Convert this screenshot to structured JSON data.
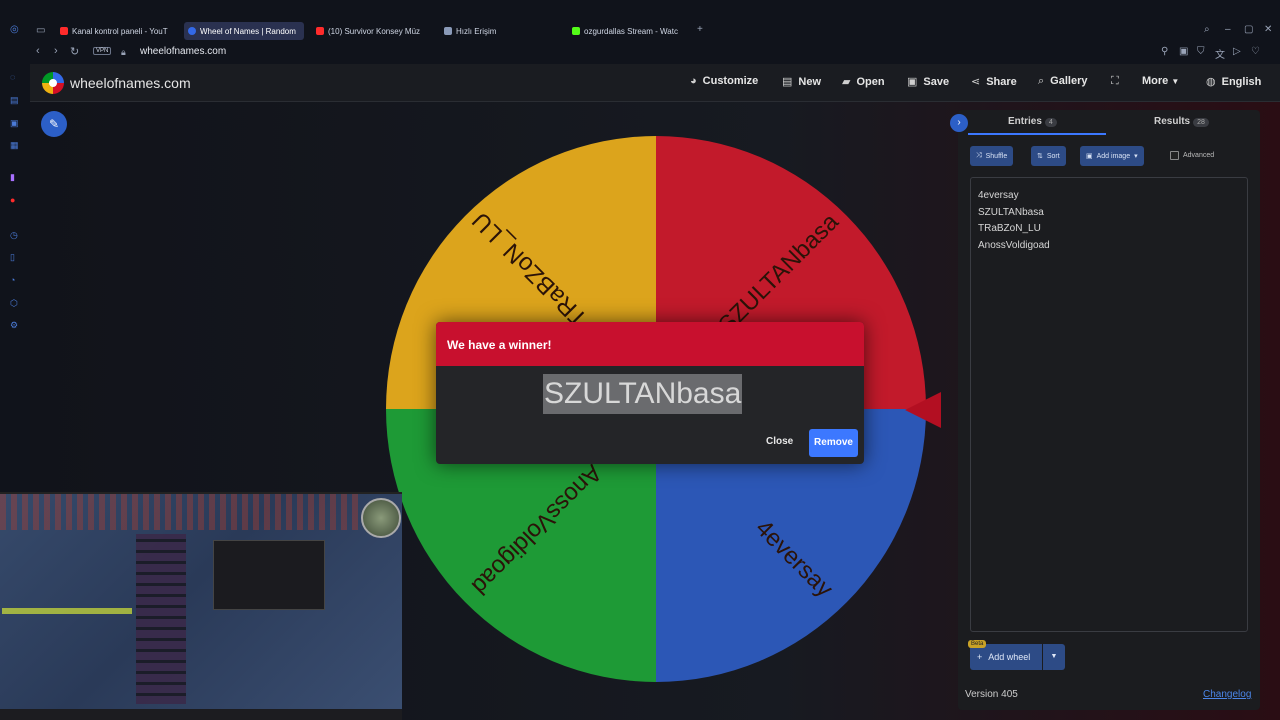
{
  "browser": {
    "tabs": [
      {
        "label": "Kanal kontrol paneli - YouT",
        "color": "#ff2b2b"
      },
      {
        "label": "Wheel of Names | Random",
        "color": "#3369e8",
        "active": true
      },
      {
        "label": "(10) Survivor Konsey Müz",
        "color": "#ff2b2b"
      },
      {
        "label": "Hızlı Erişim",
        "color": "#8a9ab8"
      },
      {
        "label": "ozgurdallas Stream - Watc",
        "color": "#53fc18"
      }
    ],
    "new_tab": "+",
    "vpn": "VPN",
    "url": "wheelofnames.com"
  },
  "header": {
    "site_title": "wheelofnames.com",
    "menu": {
      "customize": "Customize",
      "new": "New",
      "open": "Open",
      "save": "Save",
      "share": "Share",
      "gallery": "Gallery",
      "more": "More",
      "language": "English"
    },
    "icons": {
      "customize": "palette-icon",
      "new": "file-icon",
      "open": "folder-icon",
      "save": "save-icon",
      "share": "share-icon",
      "gallery": "search-icon",
      "fullscreen": "fullscreen-icon",
      "language": "globe-icon"
    }
  },
  "wheel": {
    "segments": [
      {
        "label": "SZULTANbasa",
        "color": "#c21a2b"
      },
      {
        "label": "4eversay",
        "color": "#2c57b6"
      },
      {
        "label": "AnossVoldigoad",
        "color": "#1e9a36"
      },
      {
        "label": "TRaBZoN_LU",
        "color": "#dca41c"
      }
    ]
  },
  "panel": {
    "tabs": {
      "entries": "Entries",
      "entries_count": "4",
      "results": "Results",
      "results_count": "28"
    },
    "tools": {
      "shuffle": "Shuffle",
      "sort": "Sort",
      "add_image": "Add image",
      "advanced": "Advanced"
    },
    "entries": [
      "4eversay",
      "SZULTANbasa",
      "TRaBZoN_LU",
      "AnossVoldigoad"
    ],
    "beta": "Beta",
    "add_wheel": "Add wheel",
    "version": "Version 405",
    "changelog": "Changelog"
  },
  "dialog": {
    "title": "We have a winner!",
    "winner": "SZULTANbasa",
    "close": "Close",
    "remove": "Remove"
  },
  "colors": {
    "accent": "#3c78ff",
    "dialog_header": "#c8102e",
    "header_bg": "#1a1c21"
  }
}
